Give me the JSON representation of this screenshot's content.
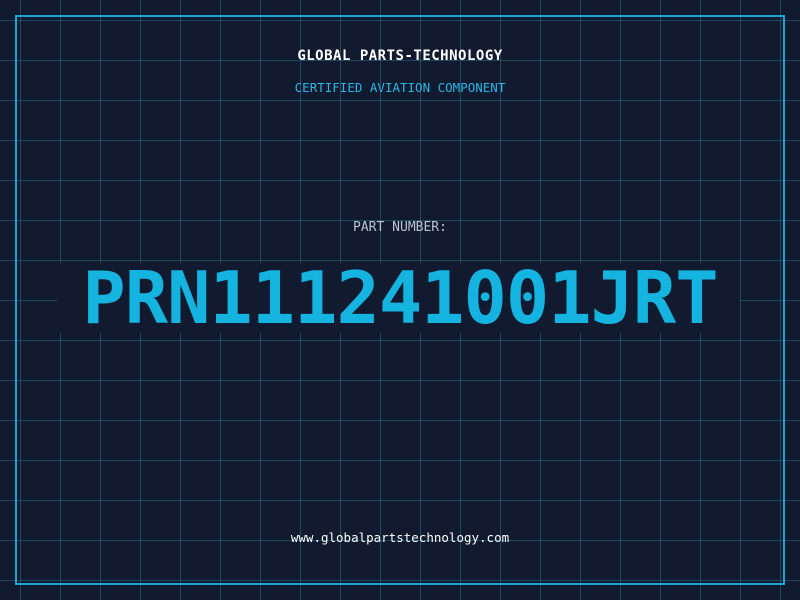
{
  "header": {
    "company": "GLOBAL PARTS-TECHNOLOGY",
    "subtitle": "CERTIFIED AVIATION COMPONENT"
  },
  "part": {
    "label": "PART NUMBER:",
    "number": "PRN111241001JRT"
  },
  "footer": {
    "website": "www.globalpartstechnology.com"
  },
  "colors": {
    "background": "#111a2e",
    "grid": "#286e8c",
    "frame": "#1fa3cf",
    "accent": "#14b3e0",
    "subtitle": "#2cb6e6",
    "label": "#b9c3d2",
    "text": "#ffffff"
  }
}
